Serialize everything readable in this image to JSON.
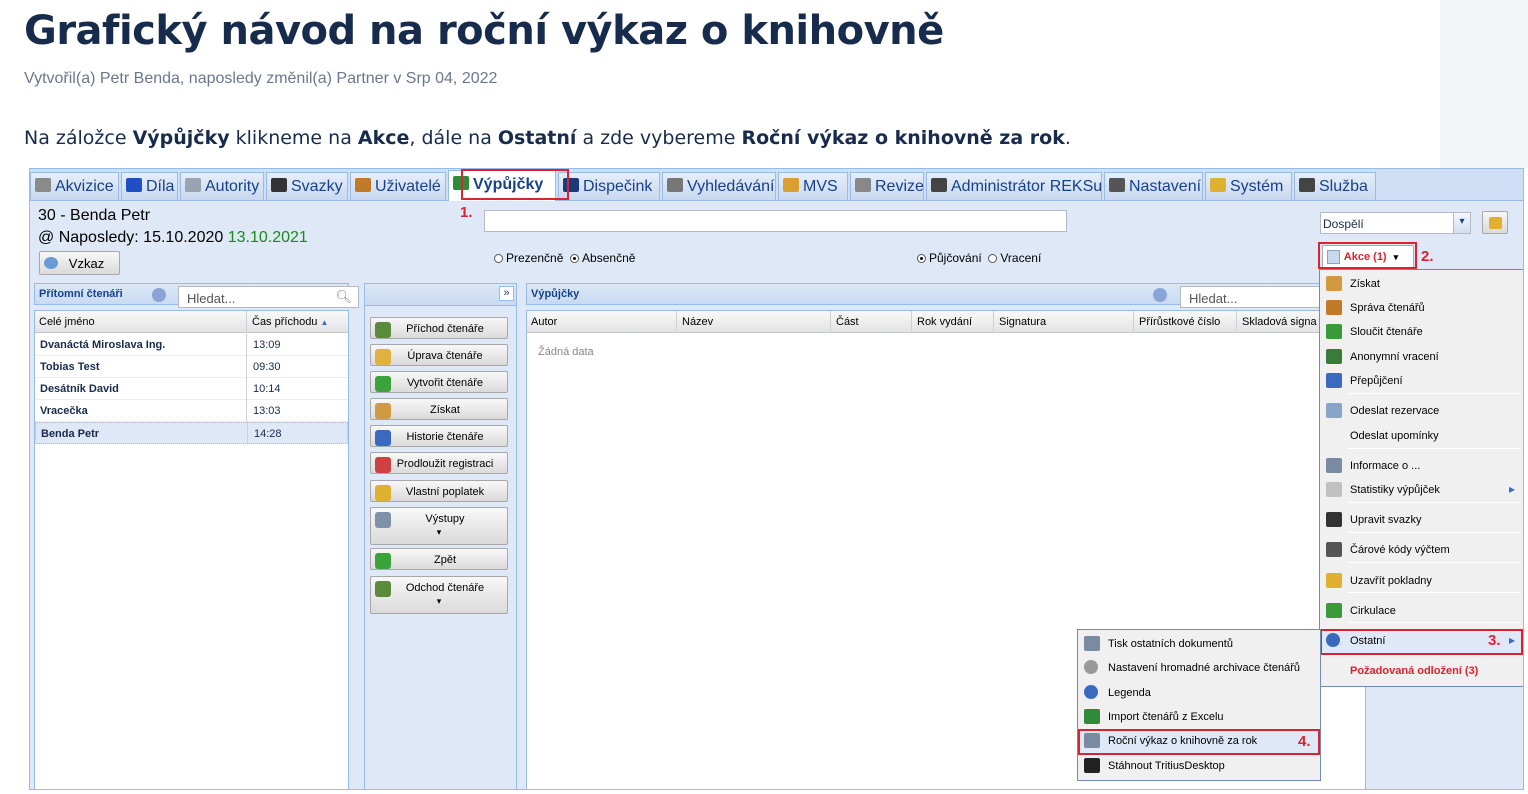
{
  "doc": {
    "title": "Grafický návod na roční výkaz o knihovně",
    "meta": "Vytvořil(a) Petr Benda, naposledy změnil(a) Partner v Srp 04, 2022",
    "para": {
      "p1": "Na záložce ",
      "b1": "Výpůjčky",
      "p2": " klikneme na ",
      "b2": "Akce",
      "p3": ", dále na ",
      "b3": "Ostatní",
      "p4": " a zde vybereme ",
      "b4": "Roční výkaz o knihovně za rok",
      "p5": "."
    }
  },
  "tabs": [
    {
      "label": "Akvizice",
      "icon": "cart-icon",
      "color": "#8a8a8a"
    },
    {
      "label": "Díla",
      "icon": "book-icon",
      "color": "#1f4fc4"
    },
    {
      "label": "Autority",
      "icon": "card-icon",
      "color": "#9aa4b0"
    },
    {
      "label": "Svazky",
      "icon": "scanner-icon",
      "color": "#333333"
    },
    {
      "label": "Uživatelé",
      "icon": "users-icon",
      "color": "#c07a2a"
    },
    {
      "label": "Výpůjčky",
      "icon": "books-icon",
      "color": "#2f8a3a"
    },
    {
      "label": "Dispečink",
      "icon": "monitor-icon",
      "color": "#1c3a7a"
    },
    {
      "label": "Vyhledávání",
      "icon": "search-doc-icon",
      "color": "#777777"
    },
    {
      "label": "MVS",
      "icon": "package-icon",
      "color": "#d8a030"
    },
    {
      "label": "Revize",
      "icon": "list-icon",
      "color": "#888888"
    },
    {
      "label": "Administrátor REKSu",
      "icon": "tools-icon",
      "color": "#444444"
    },
    {
      "label": "Nastavení",
      "icon": "wrench-icon",
      "color": "#555555"
    },
    {
      "label": "Systém",
      "icon": "key-icon",
      "color": "#e0b030"
    },
    {
      "label": "Služba",
      "icon": "tools-icon",
      "color": "#444444"
    }
  ],
  "reader": {
    "name": "30 - Benda Petr",
    "last_label": "@ Naposledy: 15.10.2020",
    "last_green": "13.10.2021",
    "message_btn": "Vzkaz"
  },
  "controls": {
    "radio_prez": "Prezenčně",
    "radio_abs": "Absenčně",
    "radio_lend": "Půjčování",
    "radio_return": "Vracení",
    "category": "Dospělí",
    "akce_btn": "Akce (1)"
  },
  "present": {
    "title": "Přítomní čtenáři",
    "search_placeholder": "Hledat...",
    "col_name": "Celé jméno",
    "col_time": "Čas příchodu",
    "rows": [
      {
        "name": "Dvanáctá Miroslava Ing.",
        "time": "13:09"
      },
      {
        "name": "Tobias Test",
        "time": "09:30"
      },
      {
        "name": "Desátník David",
        "time": "10:14"
      },
      {
        "name": "Vracečka",
        "time": "13:03"
      },
      {
        "name": "Benda Petr",
        "time": "14:28"
      }
    ]
  },
  "actions": [
    {
      "label": "Příchod čtenáře",
      "color": "#5a8a3a"
    },
    {
      "label": "Úprava čtenáře",
      "color": "#e0b040"
    },
    {
      "label": "Vytvořit čtenáře",
      "color": "#3aa33a"
    },
    {
      "label": "Získat",
      "color": "#d09a40"
    },
    {
      "label": "Historie čtenáře",
      "color": "#3a6ac0"
    },
    {
      "label": "Prodloužit registraci",
      "color": "#d04040"
    },
    {
      "label": "Vlastní poplatek",
      "color": "#e0b030"
    },
    {
      "label": "Výstupy",
      "color": "#8090a8"
    },
    {
      "label": "Zpět",
      "color": "#3aa33a"
    },
    {
      "label": "Odchod čtenáře",
      "color": "#5a8a3a"
    }
  ],
  "loans": {
    "title": "Výpůjčky",
    "search_placeholder": "Hledat...",
    "cols": [
      "Autor",
      "Název",
      "Část",
      "Rok vydání",
      "Signatura",
      "Přírůstkové číslo",
      "Skladová signa"
    ],
    "empty": "Žádná data"
  },
  "akce_menu": [
    {
      "label": "Získat",
      "icon": "hourglass-icon",
      "color": "#d09a40"
    },
    {
      "label": "Správa čtenářů",
      "icon": "users-icon",
      "color": "#c07a2a"
    },
    {
      "label": "Sloučit čtenáře",
      "icon": "merge-icon",
      "color": "#3a9a3a"
    },
    {
      "label": "Anonymní vracení",
      "icon": "return-icon",
      "color": "#3a7a3a"
    },
    {
      "label": "Přepůjčení",
      "icon": "relend-icon",
      "color": "#3a6ac0"
    },
    {
      "label": "Odeslat rezervace",
      "icon": "mail-icon",
      "color": "#8aa4c8"
    },
    {
      "label": "Odeslat upomínky",
      "icon": "",
      "color": ""
    },
    {
      "label": "Informace o ...",
      "icon": "printer-icon",
      "color": "#7a8aa0"
    },
    {
      "label": "Statistiky výpůjček",
      "icon": "doc-icon",
      "color": "#c0c0c0"
    },
    {
      "label": "Upravit svazky",
      "icon": "scanner-icon",
      "color": "#333333"
    },
    {
      "label": "Čárové kódy výčtem",
      "icon": "barcode-icon",
      "color": "#555555"
    },
    {
      "label": "Uzavřít pokladny",
      "icon": "lock-icon",
      "color": "#e0b030"
    },
    {
      "label": "Cirkulace",
      "icon": "cycle-icon",
      "color": "#3a9a3a"
    },
    {
      "label": "Ostatní",
      "icon": "info-icon",
      "color": "#3a6ac0"
    },
    {
      "label": "Požadovaná odložení (3)",
      "icon": "",
      "color": ""
    }
  ],
  "other_menu": [
    {
      "label": "Tisk ostatních dokumentů",
      "icon": "printer-icon",
      "color": "#7a8aa0"
    },
    {
      "label": "Nastavení hromadné archivace čtenářů",
      "icon": "gear-icon",
      "color": "#999999"
    },
    {
      "label": "Legenda",
      "icon": "help-icon",
      "color": "#3a6ac0"
    },
    {
      "label": "Import čtenářů z Excelu",
      "icon": "excel-icon",
      "color": "#2f8a3a"
    },
    {
      "label": "Roční výkaz o knihovně za rok",
      "icon": "printer-icon",
      "color": "#7a8aa0"
    },
    {
      "label": "Stáhnout TritiusDesktop",
      "icon": "terminal-icon",
      "color": "#222222"
    }
  ],
  "steps": [
    "1.",
    "2.",
    "3.",
    "4."
  ],
  "accent_red": "#d9232e"
}
